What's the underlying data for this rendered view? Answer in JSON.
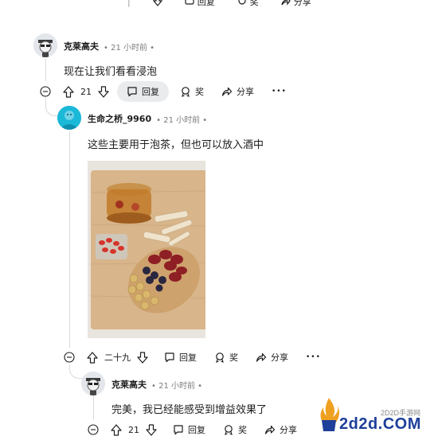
{
  "top_partial": {
    "reply_label": "回复",
    "award_label": "奖",
    "share_label": "分享"
  },
  "comments": [
    {
      "username": "克莱高夫",
      "time": "• 21 小时前 •",
      "text": "现在让我们看看浸泡",
      "votes": "21",
      "reply_label": "回复",
      "award_label": "奖",
      "share_label": "分享",
      "more_label": "•••"
    },
    {
      "username": "生命之桥_9960",
      "time": "• 21 小时前 •",
      "text": "这些主要用于泡茶，但也可以放入酒中",
      "votes": "二十九",
      "reply_label": "回复",
      "award_label": "奖",
      "share_label": "分享",
      "more_label": "•••"
    },
    {
      "username": "克莱高夫",
      "time": "• 21 小时前 •",
      "text": "完美，我已经能感受到增益效果了",
      "votes": "21",
      "reply_label": "回复",
      "award_label": "奖",
      "share_label": "分享"
    }
  ],
  "watermark": {
    "text": "2d2d.COM",
    "small": "2D2D手游网"
  },
  "colors": {
    "accent_cyan": "#1bb8d8",
    "thread": "#d7dadc",
    "meta": "#7c7c7c"
  }
}
